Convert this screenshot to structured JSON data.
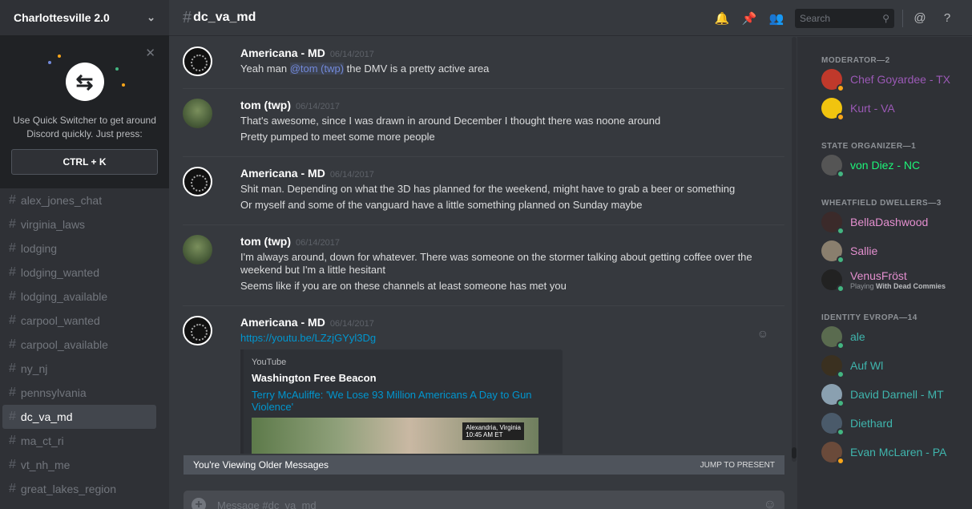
{
  "server": {
    "name": "Charlottesville 2.0"
  },
  "quick_switcher": {
    "text": "Use Quick Switcher to get around Discord quickly. Just press:",
    "shortcut": "CTRL + K"
  },
  "channels": [
    {
      "name": "alex_jones_chat"
    },
    {
      "name": "virginia_laws"
    },
    {
      "name": "lodging"
    },
    {
      "name": "lodging_wanted"
    },
    {
      "name": "lodging_available"
    },
    {
      "name": "carpool_wanted"
    },
    {
      "name": "carpool_available"
    },
    {
      "name": "ny_nj"
    },
    {
      "name": "pennsylvania"
    },
    {
      "name": "dc_va_md"
    },
    {
      "name": "ma_ct_ri"
    },
    {
      "name": "vt_nh_me"
    },
    {
      "name": "great_lakes_region"
    }
  ],
  "header": {
    "channel": "dc_va_md",
    "search_placeholder": "Search"
  },
  "messages": [
    {
      "author": "Americana - MD",
      "timestamp": "06/14/2017",
      "lines": [
        {
          "before": "Yeah man ",
          "mention": "@tom (twp)",
          "after": " the DMV is a pretty active area"
        }
      ]
    },
    {
      "author": "tom (twp)",
      "timestamp": "06/14/2017",
      "lines": [
        {
          "text": "That's awesome, since I was drawn in around December I thought there was noone around"
        },
        {
          "text": "Pretty pumped to meet some more people"
        }
      ]
    },
    {
      "author": "Americana - MD",
      "timestamp": "06/14/2017",
      "lines": [
        {
          "text": "Shit man. Depending on what the 3D has planned for the weekend, might have to grab a beer or something"
        },
        {
          "text": "Or myself and some of the vanguard have a little something planned on Sunday maybe"
        }
      ]
    },
    {
      "author": "tom (twp)",
      "timestamp": "06/14/2017",
      "lines": [
        {
          "text": "I'm always around, down for whatever. There was someone on the stormer talking about getting coffee over the weekend but I'm a little hesitant"
        },
        {
          "text": "Seems like if you are on these channels at least someone has met you"
        }
      ]
    },
    {
      "author": "Americana - MD",
      "timestamp": "06/14/2017",
      "link": "https://youtu.be/LZzjGYyl3Dg",
      "embed": {
        "provider": "YouTube",
        "author": "Washington Free Beacon",
        "title": "Terry McAuliffe: 'We Lose 93 Million Americans A Day to Gun Violence'",
        "thumb_caption": "Alexandria, Virginia",
        "thumb_time": "10:45 AM ET"
      }
    }
  ],
  "older_bar": {
    "text": "You're Viewing Older Messages",
    "jump": "JUMP TO PRESENT"
  },
  "composer": {
    "placeholder": "Message #dc_va_md"
  },
  "members": {
    "groups": [
      {
        "role": "MODERATOR—2",
        "items": [
          {
            "name": "Chef Goyardee - TX",
            "color": "#9b59b6",
            "status": "#faa61a",
            "avatar": "#c0392b"
          },
          {
            "name": "Kurt - VA",
            "color": "#9b59b6",
            "status": "#faa61a",
            "avatar": "#f1c40f"
          }
        ]
      },
      {
        "role": "STATE ORGANIZER—1",
        "items": [
          {
            "name": "von Diez - NC",
            "color": "#1df579",
            "status": "#43b581",
            "avatar": "#555555"
          }
        ]
      },
      {
        "role": "WHEATFIELD DWELLERS—3",
        "items": [
          {
            "name": "BellaDashwood",
            "color": "#e48fcf",
            "status": "#43b581",
            "avatar": "#3b2a2a"
          },
          {
            "name": "Sallie",
            "color": "#e48fcf",
            "status": "#43b581",
            "avatar": "#8a7f6e"
          },
          {
            "name": "VenusFröst",
            "color": "#e48fcf",
            "status": "#43b581",
            "avatar": "#222222",
            "game_prefix": "Playing",
            "game": "With Dead Commies"
          }
        ]
      },
      {
        "role": "IDENTITY EVROPA—14",
        "items": [
          {
            "name": "ale",
            "color": "#3fb5ad",
            "status": "#43b581",
            "avatar": "#5a6b4f"
          },
          {
            "name": "Auf Wl",
            "color": "#3fb5ad",
            "status": "#43b581",
            "avatar": "#3a3020"
          },
          {
            "name": "David Darnell - MT",
            "color": "#3fb5ad",
            "status": "#43b581",
            "avatar": "#8aa0b0"
          },
          {
            "name": "Diethard",
            "color": "#3fb5ad",
            "status": "#43b581",
            "avatar": "#4a5a6a"
          },
          {
            "name": "Evan McLaren - PA",
            "color": "#3fb5ad",
            "status": "#faa61a",
            "avatar": "#6a4a3a"
          }
        ]
      }
    ]
  }
}
